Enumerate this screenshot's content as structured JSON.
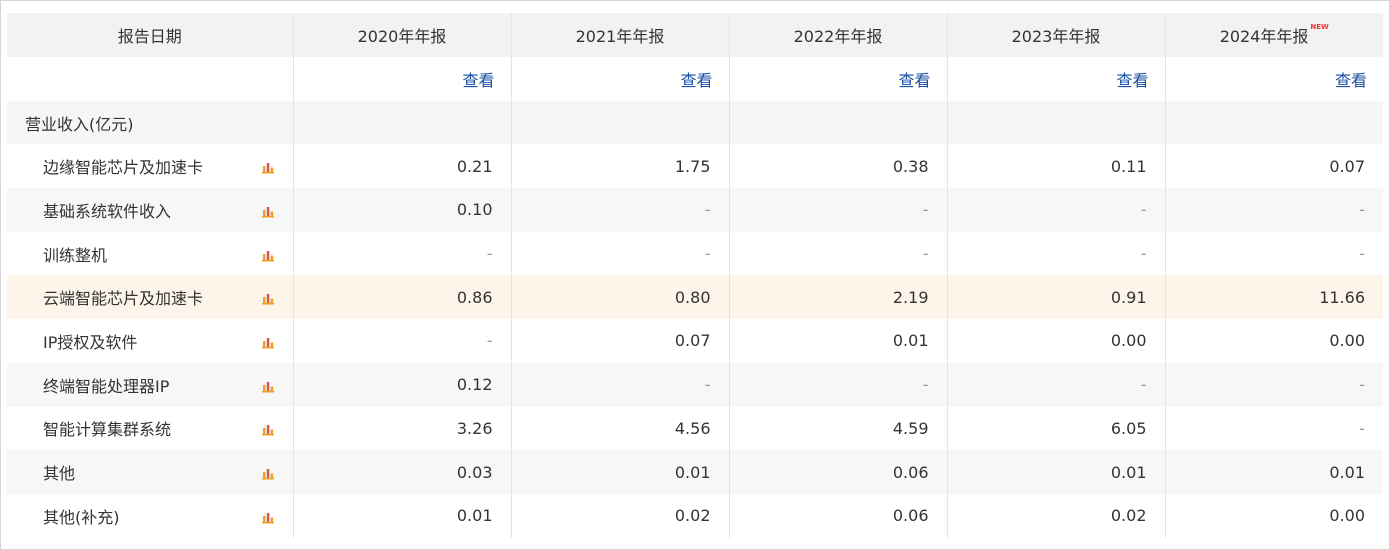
{
  "header": {
    "first_col": "报告日期",
    "years": [
      {
        "label": "2020年年报",
        "badge": ""
      },
      {
        "label": "2021年年报",
        "badge": ""
      },
      {
        "label": "2022年年报",
        "badge": ""
      },
      {
        "label": "2023年年报",
        "badge": ""
      },
      {
        "label": "2024年年报",
        "badge": "NEW"
      }
    ]
  },
  "view_link_label": "查看",
  "section_title": "营业收入(亿元)",
  "rows": [
    {
      "name": "边缘智能芯片及加速卡",
      "values": [
        "0.21",
        "1.75",
        "0.38",
        "0.11",
        "0.07"
      ]
    },
    {
      "name": "基础系统软件收入",
      "values": [
        "0.10",
        "-",
        "-",
        "-",
        "-"
      ]
    },
    {
      "name": "训练整机",
      "values": [
        "-",
        "-",
        "-",
        "-",
        "-"
      ]
    },
    {
      "name": "云端智能芯片及加速卡",
      "values": [
        "0.86",
        "0.80",
        "2.19",
        "0.91",
        "11.66"
      ],
      "highlight": true
    },
    {
      "name": "IP授权及软件",
      "values": [
        "-",
        "0.07",
        "0.01",
        "0.00",
        "0.00"
      ]
    },
    {
      "name": "终端智能处理器IP",
      "values": [
        "0.12",
        "-",
        "-",
        "-",
        "-"
      ]
    },
    {
      "name": "智能计算集群系统",
      "values": [
        "3.26",
        "4.56",
        "4.59",
        "6.05",
        "-"
      ]
    },
    {
      "name": "其他",
      "values": [
        "0.03",
        "0.01",
        "0.06",
        "0.01",
        "0.01"
      ]
    },
    {
      "name": "其他(补充)",
      "values": [
        "0.01",
        "0.02",
        "0.06",
        "0.02",
        "0.00"
      ]
    }
  ],
  "colors": {
    "header_bg": "#f2f2f2",
    "link": "#1a4fa3",
    "highlight_row": "#fdf4ea",
    "chart_icon_orange": "#f0a020",
    "chart_icon_red": "#d9534f"
  },
  "icons": {
    "row_chart": "bar-chart-icon"
  }
}
